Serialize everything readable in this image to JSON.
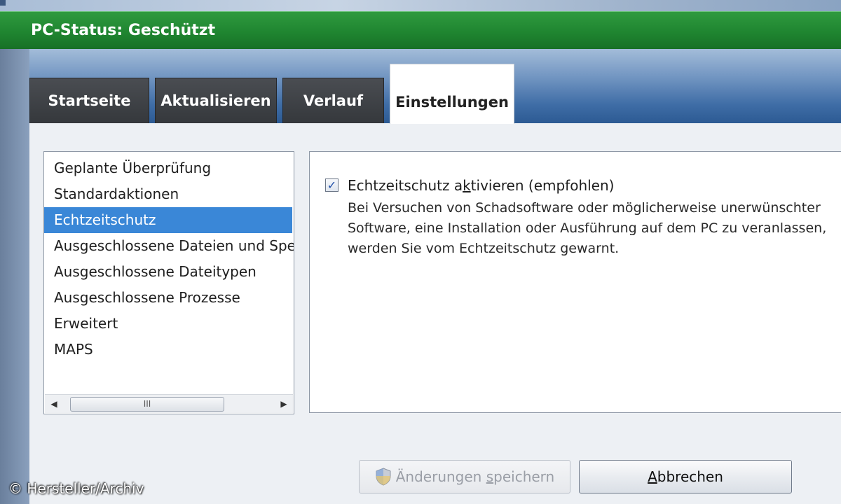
{
  "status": {
    "title": "PC-Status: Geschützt",
    "bar_color": "#1f8530"
  },
  "tabs": [
    {
      "label": "Startseite",
      "active": false
    },
    {
      "label": "Aktualisieren",
      "active": false
    },
    {
      "label": "Verlauf",
      "active": false
    },
    {
      "label": "Einstellungen",
      "active": true
    }
  ],
  "settings_nav": {
    "items": [
      {
        "label": "Geplante Überprüfung",
        "selected": false
      },
      {
        "label": "Standardaktionen",
        "selected": false
      },
      {
        "label": "Echtzeitschutz",
        "selected": true
      },
      {
        "label": "Ausgeschlossene Dateien und Speicherorte",
        "selected": false
      },
      {
        "label": "Ausgeschlossene Dateitypen",
        "selected": false
      },
      {
        "label": "Ausgeschlossene Prozesse",
        "selected": false
      },
      {
        "label": "Erweitert",
        "selected": false
      },
      {
        "label": "MAPS",
        "selected": false
      }
    ],
    "scroll_thumb_grip": "III",
    "selected_color": "#3a87d7"
  },
  "realtime": {
    "checkbox_checked": true,
    "label_pre": "Echtzeitschutz a",
    "label_accel": "k",
    "label_post": "tivieren (empfohlen)",
    "description": "Bei Versuchen von Schadsoftware oder möglicherweise unerwünschter Software, eine  Installation oder Ausführung auf dem PC zu veranlassen,  werden Sie vom Echtzeitschutz gewarnt."
  },
  "buttons": {
    "save_pre": "Änderungen ",
    "save_accel": "s",
    "save_post": "peichern",
    "save_enabled": false,
    "cancel_accel": "A",
    "cancel_post": "bbrechen"
  },
  "footer": {
    "copyright": "© Hersteller/Archiv"
  }
}
